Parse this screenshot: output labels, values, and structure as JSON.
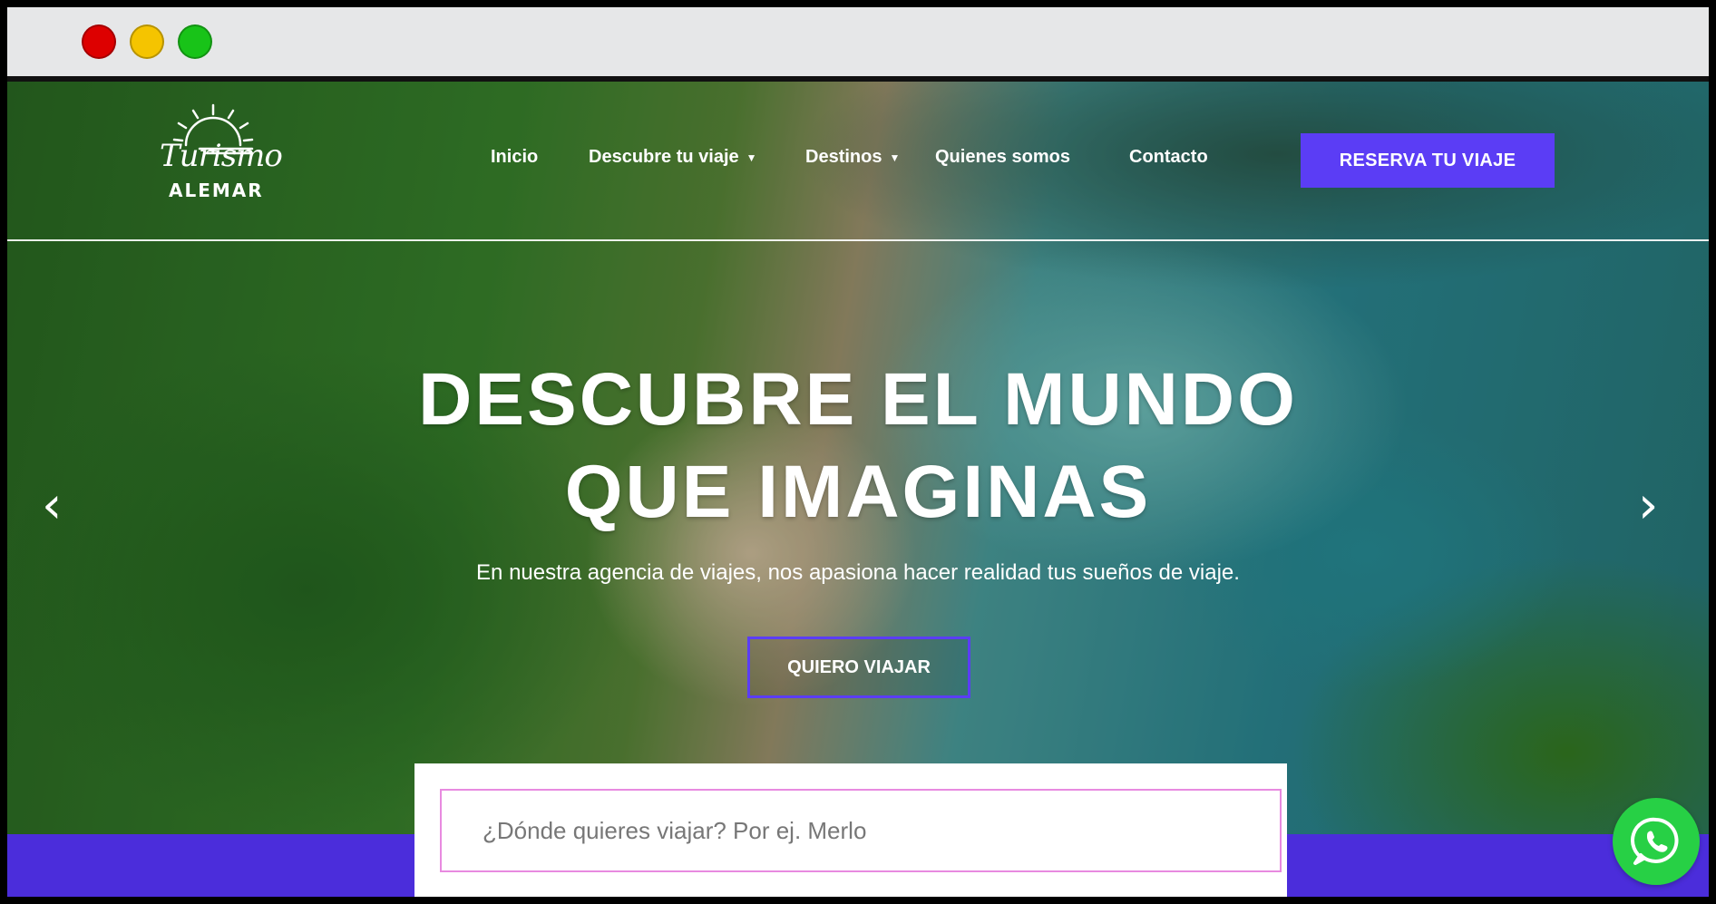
{
  "window": {
    "controls": [
      "close",
      "minimize",
      "maximize"
    ]
  },
  "brand": {
    "script": "Turismo",
    "word": "ALEMAR",
    "icon": "sun-logo-icon"
  },
  "nav": {
    "items": [
      {
        "label": "Inicio",
        "has_dropdown": false
      },
      {
        "label": "Descubre tu viaje",
        "has_dropdown": true
      },
      {
        "label": "Destinos",
        "has_dropdown": true
      },
      {
        "label": "Quienes somos",
        "has_dropdown": false
      },
      {
        "label": "Contacto",
        "has_dropdown": false
      }
    ],
    "cta_label": "RESERVA TU VIAJE"
  },
  "hero": {
    "headline_line1": "DESCUBRE EL MUNDO",
    "headline_line2": "QUE IMAGINAS",
    "subtitle": "En nuestra agencia de viajes, nos apasiona hacer realidad tus sueños de viaje.",
    "cta_label": "QUIERO VIAJAR",
    "prev_icon": "chevron-left-icon",
    "next_icon": "chevron-right-icon"
  },
  "search": {
    "placeholder": "¿Dónde quieres viajar? Por ej. Merlo",
    "value": ""
  },
  "colors": {
    "accent": "#5b3df5",
    "band": "#4b2ddb",
    "whatsapp": "#27d045",
    "input_border": "#e88ae0"
  },
  "floating": {
    "whatsapp_icon": "whatsapp-icon"
  }
}
